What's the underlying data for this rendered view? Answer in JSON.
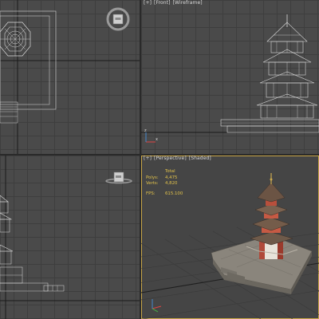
{
  "viewports": {
    "front": {
      "label_parts": [
        "[+]",
        "[Front]",
        "[Wireframe]"
      ]
    },
    "perspective": {
      "label_parts": [
        "[+]",
        "[Perspective]",
        "[Shaded]"
      ]
    }
  },
  "stats": {
    "total_label": "Total",
    "polys_label": "Polys:",
    "polys_value": "4,475",
    "verts_label": "Verts:",
    "verts_value": "4,820",
    "fps_label": "FPS:",
    "fps_value": "615.100"
  },
  "colors": {
    "viewport_bg": "#4a4a4a",
    "grid_line": "#3e3e3e",
    "wireframe": "#d9d9d9",
    "active_border": "#c8a547",
    "stats_text": "#e2c24a"
  },
  "icons": {
    "viewcube_top": "viewcube-top-icon",
    "viewcube_left": "viewcube-left-icon",
    "axis_tripod": "axis-tripod-icon"
  }
}
